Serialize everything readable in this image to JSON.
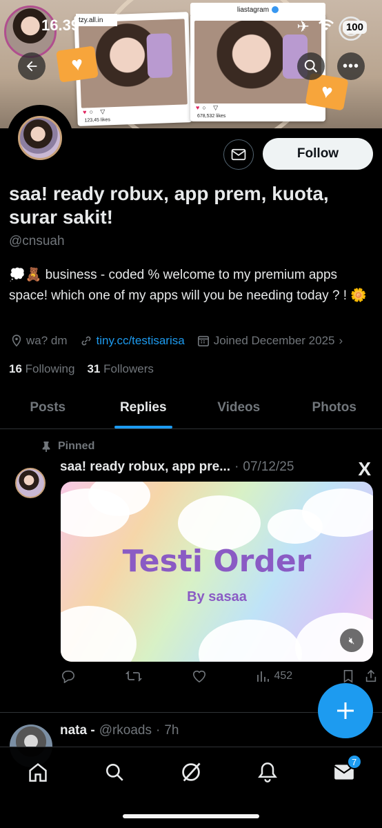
{
  "status_bar": {
    "time": "16.39",
    "battery": "100"
  },
  "banner": {
    "tag_text": "tzy.all.in",
    "ig_title": "liastagram",
    "card1_likes": "123,45 likes",
    "card2_likes": "678,532 likes"
  },
  "profile": {
    "follow_label": "Follow",
    "display_name": "saa! ready robux, app prem, kuota, surar sakit!",
    "handle": "@cnsuah",
    "bio": "💭🧸 business - coded % welcome to my premium apps space! which one of my apps will you be needing today ? ! 🌼",
    "location": "wa? dm",
    "link": "tiny.cc/testisarisa",
    "joined": "Joined December 2025",
    "following_count": "16",
    "following_label": "Following",
    "followers_count": "31",
    "followers_label": "Followers"
  },
  "tabs": [
    {
      "label": "Posts"
    },
    {
      "label": "Replies"
    },
    {
      "label": "Videos"
    },
    {
      "label": "Photos"
    }
  ],
  "pinned_post": {
    "pinned_label": "Pinned",
    "name": "saa! ready robux, app pre...",
    "separator": "·",
    "date": "07/12/25",
    "x_logo": "X",
    "media_title": "Testi Order",
    "media_by": "By sasaa",
    "views": "452"
  },
  "next_post": {
    "name": "nata -",
    "handle": "@rkoads",
    "separator": "·",
    "time": "7h"
  },
  "bottom_nav": {
    "messages_badge": "7"
  },
  "colors": {
    "accent": "#1d9bf0",
    "background": "#000000",
    "muted": "#71767b"
  }
}
